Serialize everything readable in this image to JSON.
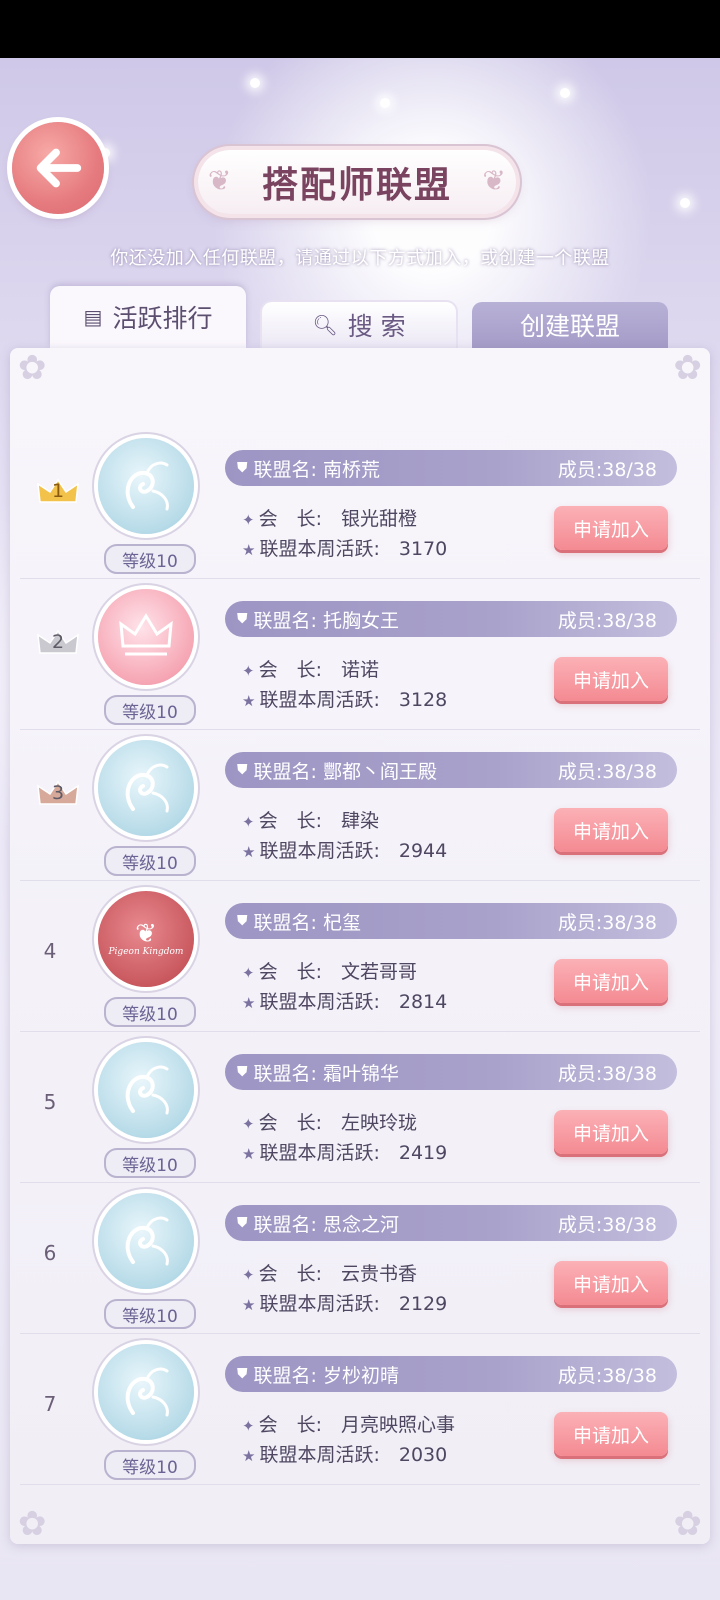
{
  "header": {
    "title": "搭配师联盟",
    "hint": "你还没加入任何联盟，请通过以下方式加入，或创建一个联盟"
  },
  "tabs": {
    "ranking": "活跃排行",
    "search": "搜 索",
    "create": "创建联盟"
  },
  "labels": {
    "name_prefix": "联盟名:",
    "leader_prefix": "会　长:",
    "activity_prefix": "联盟本周活跃:",
    "apply": "申请加入"
  },
  "unions": [
    {
      "rank": "1",
      "name": "南桥荒",
      "members": "成员:38/38",
      "leader": "银光甜橙",
      "activity": "3170",
      "level": "等级10",
      "emblem": "blue",
      "crown": "gold"
    },
    {
      "rank": "2",
      "name": "托胸女王",
      "members": "成员:38/38",
      "leader": "诺诺",
      "activity": "3128",
      "level": "等级10",
      "emblem": "pink",
      "crown": "silver"
    },
    {
      "rank": "3",
      "name": "酆都丶阎王殿",
      "members": "成员:38/38",
      "leader": "肆染",
      "activity": "2944",
      "level": "等级10",
      "emblem": "blue",
      "crown": "bronze"
    },
    {
      "rank": "4",
      "name": "杞玺",
      "members": "成员:38/38",
      "leader": "文若哥哥",
      "activity": "2814",
      "level": "等级10",
      "emblem": "red",
      "crown": ""
    },
    {
      "rank": "5",
      "name": "霜叶锦华",
      "members": "成员:38/38",
      "leader": "左映玲珑",
      "activity": "2419",
      "level": "等级10",
      "emblem": "blue",
      "crown": ""
    },
    {
      "rank": "6",
      "name": "思念之河",
      "members": "成员:38/38",
      "leader": "云贵书香",
      "activity": "2129",
      "level": "等级10",
      "emblem": "blue",
      "crown": ""
    },
    {
      "rank": "7",
      "name": "岁杪初晴",
      "members": "成员:38/38",
      "leader": "月亮映照心事",
      "activity": "2030",
      "level": "等级10",
      "emblem": "blue",
      "crown": ""
    }
  ],
  "emblem_text": "Pigeon Kingdom",
  "colors": {
    "accent_purple": "#9d95c3",
    "apply_pink": "#f48a92",
    "back_button": "#e67b7f",
    "crown_gold": "#f2c24a",
    "crown_silver": "#c9c9cf",
    "crown_bronze": "#d6a99a"
  },
  "icons": {
    "back": "arrow-left-icon",
    "ranking": "list-icon",
    "search": "magnifier-icon",
    "leader": "sparkle-icon",
    "activity": "star-icon",
    "shield": "shield-icon"
  }
}
